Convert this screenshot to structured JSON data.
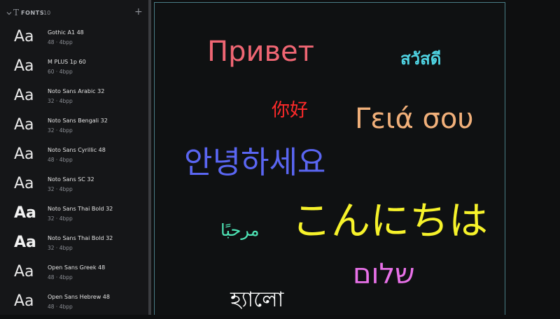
{
  "header": {
    "title": "FONTS",
    "count": "10"
  },
  "fonts": [
    {
      "name": "Gothic A1 48",
      "meta": "48 · 4bpp",
      "preview": "Aa",
      "weight": "thin"
    },
    {
      "name": "M PLUS 1p 60",
      "meta": "60 · 4bpp",
      "preview": "Aa",
      "weight": "thin"
    },
    {
      "name": "Noto Sans Arabic 32",
      "meta": "32 · 4bpp",
      "preview": "Aa",
      "weight": "thin"
    },
    {
      "name": "Noto Sans Bengali 32",
      "meta": "32 · 4bpp",
      "preview": "Aa",
      "weight": "thin"
    },
    {
      "name": "Noto Sans Cyrillic 48",
      "meta": "48 · 4bpp",
      "preview": "Aa",
      "weight": "thin"
    },
    {
      "name": "Noto Sans SC 32",
      "meta": "32 · 4bpp",
      "preview": "Aa",
      "weight": "thin"
    },
    {
      "name": "Noto Sans Thai Bold 32",
      "meta": "32 · 4bpp",
      "preview": "Aa",
      "weight": "bold"
    },
    {
      "name": "Noto Sans Thai Bold 32",
      "meta": "32 · 4bpp",
      "preview": "Aa",
      "weight": "bold"
    },
    {
      "name": "Open Sans Greek 48",
      "meta": "48 · 4bpp",
      "preview": "Aa",
      "weight": "thin"
    },
    {
      "name": "Open Sans Hebrew 48",
      "meta": "48 · 4bpp",
      "preview": "Aa",
      "weight": "thin"
    }
  ],
  "canvas": {
    "russian": "Привет",
    "thai": "สวัสดี",
    "chinese": "你好",
    "greek": "Γειά σου",
    "korean": "안녕하세요",
    "japanese": "こんにちは",
    "arabic": "مرحبًا",
    "hebrew": "שלום",
    "bengali": "হ্যালো"
  },
  "colors": {
    "russian": "#ef6673",
    "thai": "#4fd3e2",
    "chinese": "#ff2a2a",
    "greek": "#f1b07a",
    "korean": "#5a66f2",
    "japanese": "#f6f22a",
    "arabic": "#4ee5b6",
    "hebrew": "#e871e8",
    "bengali": "#ffffff",
    "canvas_border": "#4a7d86"
  }
}
